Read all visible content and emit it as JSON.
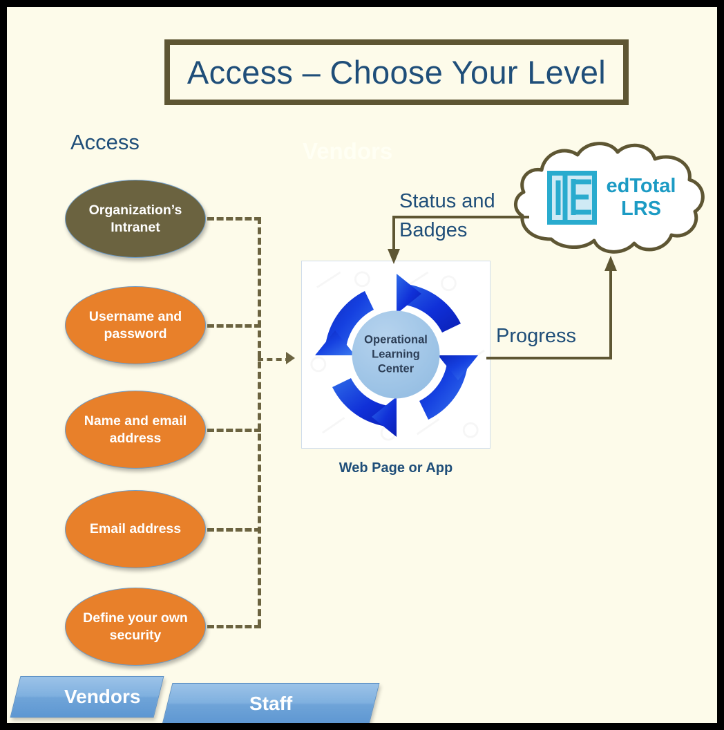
{
  "slide": {
    "title": "Access – Choose Your Level",
    "background_color": "#FDFBEA",
    "frame_color": "#000000",
    "title_border_color": "#5E5633",
    "title_text_color": "#1F4E79"
  },
  "labels": {
    "access": "Access",
    "vendors_ghost": "Vendors"
  },
  "access_levels": [
    {
      "label": "Organization’s Intranet",
      "color": "#6B6340"
    },
    {
      "label": "Username and password",
      "color": "#E8802A"
    },
    {
      "label": "Name and email address",
      "color": "#E8802A"
    },
    {
      "label": "Email address",
      "color": "#E8802A"
    },
    {
      "label": "Define your own security",
      "color": "#E8802A"
    }
  ],
  "center": {
    "circle_line_1": "Operational",
    "circle_line_2": "Learning",
    "circle_line_3": "Center",
    "caption": "Web Page or App",
    "arrow_color": "#1540E0"
  },
  "cloud": {
    "logo_name": "edtotal-lrs-logo",
    "title_line_1": "edTotal",
    "title_line_2": "LRS",
    "text_color": "#1C9BC4",
    "outline_color": "#5E5633"
  },
  "flows": {
    "status_line_1": "Status and",
    "status_line_2": "Badges",
    "progress": "Progress",
    "connector_color": "#6B6340"
  },
  "banners": [
    {
      "label": "Vendors"
    },
    {
      "label": "Staff"
    }
  ]
}
